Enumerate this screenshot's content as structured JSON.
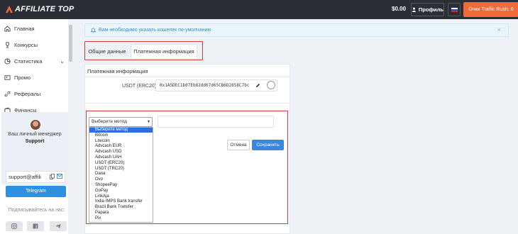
{
  "header": {
    "logo_text": "AFFILIATE TOP",
    "balance": "$0.00",
    "profile_label": "Профиль",
    "rush_label": "Очки Traffic Rush: 0"
  },
  "sidebar": {
    "items": [
      {
        "label": "Главная",
        "icon": "home-icon"
      },
      {
        "label": "Конкурсы",
        "icon": "trophy-icon"
      },
      {
        "label": "Статистика",
        "icon": "chart-icon"
      },
      {
        "label": "Промо",
        "icon": "promo-icon"
      },
      {
        "label": "Рефералы",
        "icon": "link-icon"
      },
      {
        "label": "Финансы",
        "icon": "wallet-icon"
      }
    ],
    "manager": {
      "title": "Ваш личный менеджер",
      "name": "Support",
      "email": "support@affili",
      "telegram_label": "Telegram"
    },
    "subscribe_label": "Подписывайтесь на нас:"
  },
  "alert": {
    "text": "Вам необходимо указать кошелек по-умолчанию"
  },
  "tabs": [
    {
      "label": "Общие данные",
      "active": false
    },
    {
      "label": "Платежная информация",
      "active": true
    }
  ],
  "payment": {
    "title": "Платежная информация",
    "wallet_label": "USDT (ERC20)",
    "wallet_value": "0x1A5DEC1b07Eb82dd67d65CB6D2858C7bc",
    "method_placeholder": "Выберите метод",
    "methods": [
      "Выберите метод",
      "Bitcoin",
      "Litecoin",
      "Advcash EUR",
      "Advcash USD",
      "Advcash UAH",
      "USDT (ERC20)",
      "USDT (TRC20)",
      "Dana",
      "Ovo",
      "ShopeePay",
      "GoPay",
      "LinkAja",
      "India IMPS Bank transfer",
      "Brazil Bank Transfer",
      "Papara",
      "Pix"
    ],
    "cancel_label": "Отмена",
    "save_label": "Сохранить"
  },
  "colors": {
    "topbar": "#2b2f35",
    "accent_orange": "#f36a3a",
    "primary_blue": "#3a86e0",
    "highlight_red": "#d93838"
  }
}
